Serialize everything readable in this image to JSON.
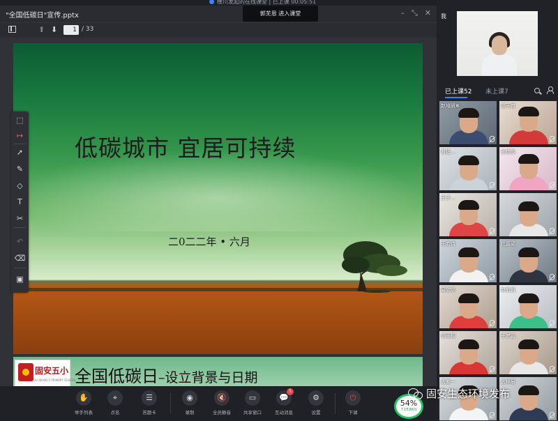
{
  "window": {
    "recording_text": "楼川发起的在线课堂 | 已上课 00:05:51",
    "controls": [
      "–",
      "⤡",
      "✕"
    ]
  },
  "ppt": {
    "file_title": "\"全国低碳日\"宣传.pptx",
    "page_current": "1",
    "page_total": "/ 33"
  },
  "toast": "郭芜恩 进入课堂",
  "slide1": {
    "title": "低碳城市  宜居可持续",
    "date": "二0二二年 • 六月"
  },
  "slide2": {
    "logo_name": "固安五小",
    "logo_sub": "GU AN NO.5 PRIMARY SCHOOL",
    "heading_main": "全国低碳日",
    "heading_sub": "–设立背景与日期"
  },
  "tools": [
    "selection-box-icon",
    "laser-pointer-icon",
    "cursor-icon",
    "pen-icon",
    "shape-icon",
    "text-icon",
    "scissors-icon",
    "undo-icon",
    "eraser-icon",
    "toolbox-icon"
  ],
  "right": {
    "me_label": "我",
    "tab_on": "已上课52",
    "tab_off": "未上课7"
  },
  "students": [
    {
      "name": "赵培凯✻"
    },
    {
      "name": "郭天育"
    },
    {
      "name": "曹纸..."
    },
    {
      "name": "孙佳欣"
    },
    {
      "name": "王子..."
    },
    {
      "name": ""
    },
    {
      "name": "王若诗"
    },
    {
      "name": "杜嘉硕"
    },
    {
      "name": "易欣然"
    },
    {
      "name": "赵航帆"
    },
    {
      "name": "郭雨桐"
    },
    {
      "name": "王梦嘉"
    },
    {
      "name": "孟紫一"
    },
    {
      "name": "孟梓辰"
    }
  ],
  "toolbar": {
    "hand_label": "举手列表",
    "rollcall_label": "点名",
    "answer_label": "答题卡",
    "record_label": "录制",
    "mute_label": "全员静音",
    "share_label": "共享窗口",
    "message_label": "互动消息",
    "message_badge": "5",
    "settings_label": "设置",
    "end_label": "下课"
  },
  "network": {
    "percent": "54%",
    "rate": "↑153K/s"
  },
  "watermark": "固安生态环境发布"
}
